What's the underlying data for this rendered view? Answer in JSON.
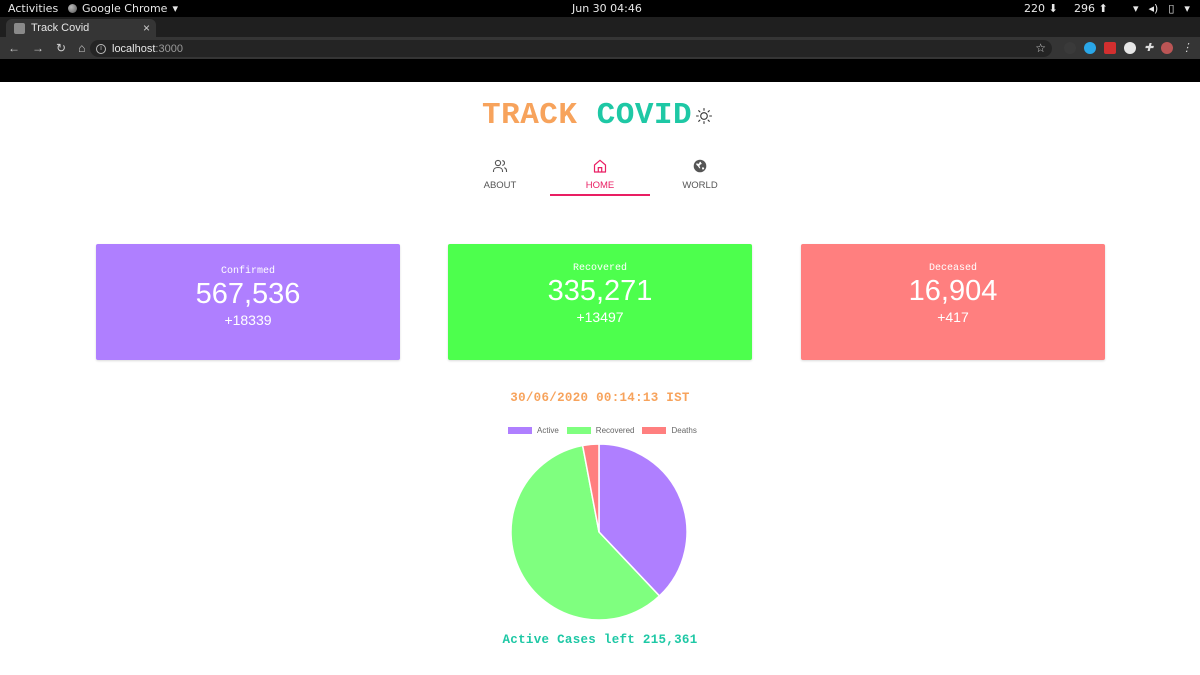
{
  "os": {
    "activities": "Activities",
    "app_name": "Google Chrome",
    "clock": "Jun 30  04:46",
    "net_down": "220",
    "net_up": "296"
  },
  "browser": {
    "tab_title": "Track Covid",
    "url_host": "localhost",
    "url_port": ":3000"
  },
  "brand": {
    "word1": "TRACK",
    "word2": "COVID"
  },
  "nav": {
    "items": [
      {
        "label": "ABOUT",
        "icon": "users-icon"
      },
      {
        "label": "HOME",
        "icon": "home-icon",
        "active": true
      },
      {
        "label": "WORLD",
        "icon": "globe-icon"
      }
    ]
  },
  "cards": {
    "confirmed": {
      "label": "Confirmed",
      "value": "567,536",
      "delta": "+18339",
      "color": "#af7fff"
    },
    "recovered": {
      "label": "Recovered",
      "value": "335,271",
      "delta": "+13497",
      "color": "#4dff4d"
    },
    "deceased": {
      "label": "Deceased",
      "value": "16,904",
      "delta": "+417",
      "color": "#ff7f7f"
    }
  },
  "timestamp": "30/06/2020 00:14:13 IST",
  "active_text": "Active Cases left 215,361",
  "chart_data": {
    "type": "pie",
    "categories": [
      "Active",
      "Recovered",
      "Deaths"
    ],
    "values": [
      215361,
      335271,
      16904
    ],
    "colors": [
      "#af7fff",
      "#7fff7f",
      "#ff7f7f"
    ],
    "legend": "top"
  },
  "colors": {
    "accent_home": "#e91e63",
    "brand_orange": "#f7a35c",
    "brand_teal": "#1ec8a5"
  }
}
